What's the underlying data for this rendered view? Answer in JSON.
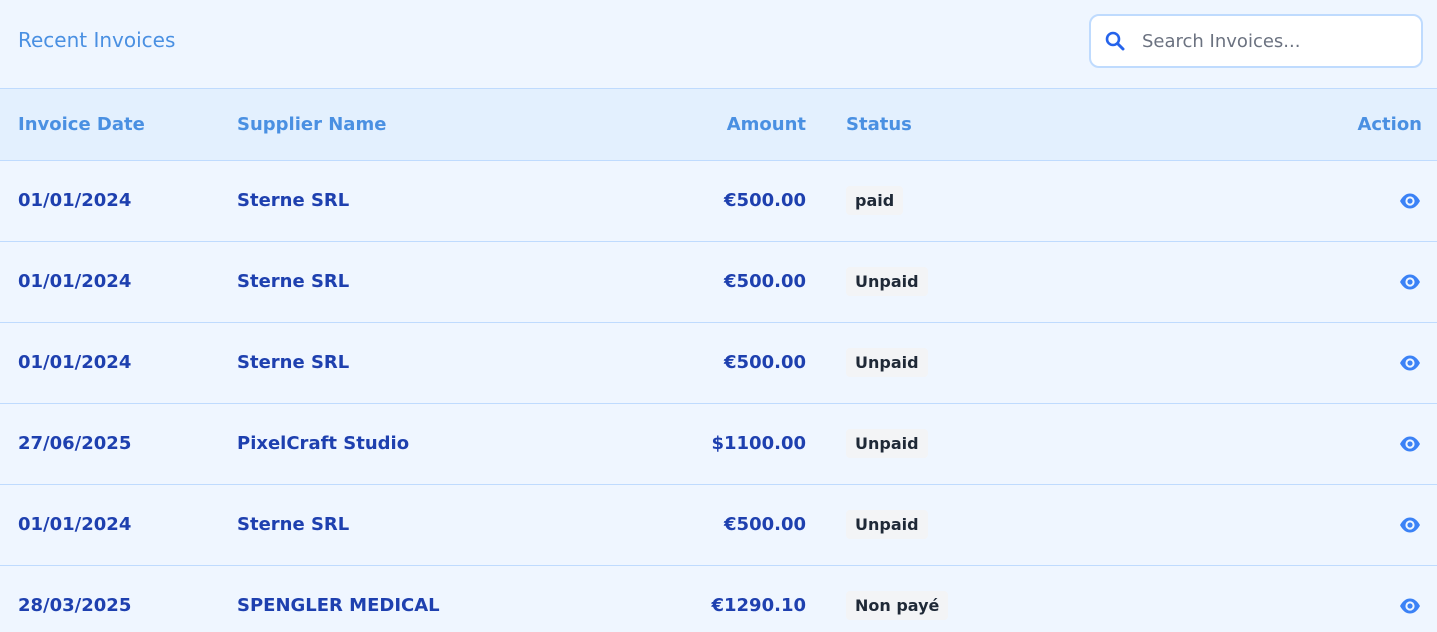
{
  "header": {
    "title": "Recent Invoices",
    "search_placeholder": "Search Invoices..."
  },
  "table": {
    "columns": {
      "date": "Invoice Date",
      "supplier": "Supplier Name",
      "amount": "Amount",
      "status": "Status",
      "action": "Action"
    },
    "rows": [
      {
        "date": "01/01/2024",
        "supplier": "Sterne SRL",
        "amount": "€500.00",
        "status": "paid"
      },
      {
        "date": "01/01/2024",
        "supplier": "Sterne SRL",
        "amount": "€500.00",
        "status": "Unpaid"
      },
      {
        "date": "01/01/2024",
        "supplier": "Sterne SRL",
        "amount": "€500.00",
        "status": "Unpaid"
      },
      {
        "date": "27/06/2025",
        "supplier": "PixelCraft Studio",
        "amount": "$1100.00",
        "status": "Unpaid"
      },
      {
        "date": "01/01/2024",
        "supplier": "Sterne SRL",
        "amount": "€500.00",
        "status": "Unpaid"
      },
      {
        "date": "28/03/2025",
        "supplier": "SPENGLER MEDICAL",
        "amount": "€1290.10",
        "status": "Non payé"
      }
    ]
  },
  "icons": {
    "search": "search-icon",
    "view": "eye-icon"
  },
  "colors": {
    "accent": "#4a90e2",
    "text_dark": "#1e40af",
    "background": "#eff6ff",
    "header_row": "#e3f0fe",
    "border": "#bfdbfe",
    "badge_bg": "#f3f4f6"
  }
}
